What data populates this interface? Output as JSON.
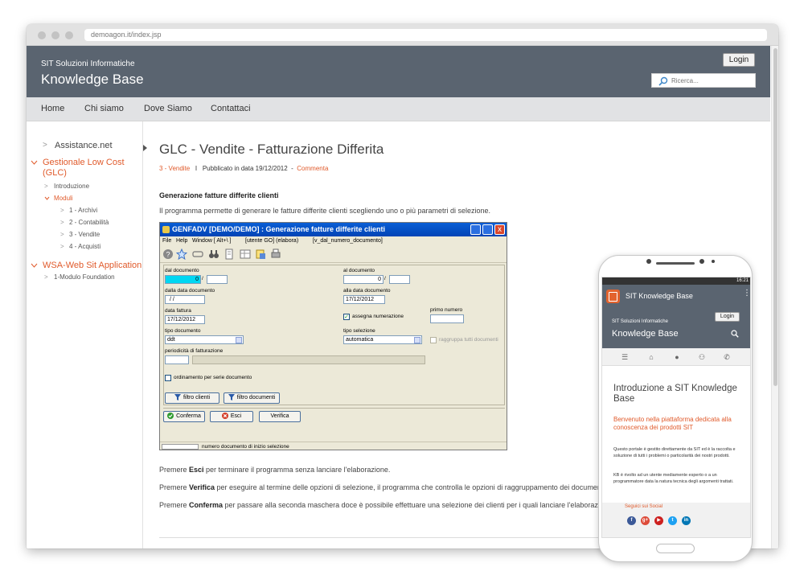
{
  "browser": {
    "url": "demoagon.it/index.jsp"
  },
  "header": {
    "company": "SIT Soluzioni Informatiche",
    "title": "Knowledge Base",
    "login_label": "Login",
    "search_placeholder": "Ricerca..."
  },
  "nav": {
    "items": [
      "Home",
      "Chi siamo",
      "Dove Siamo",
      "Contattaci"
    ]
  },
  "sidebar": {
    "items": [
      {
        "label": "Assistance.net"
      },
      {
        "label_line1": "Gestionale Low Cost",
        "label_line2": "(GLC)"
      },
      {
        "label": "Introduzione"
      },
      {
        "label": "Moduli"
      },
      {
        "label": "1 - Archivi"
      },
      {
        "label": "2 - Contabilità"
      },
      {
        "label": "3 - Vendite"
      },
      {
        "label": "4 - Acquisti"
      },
      {
        "label": "WSA-Web Sit Application"
      },
      {
        "label": "1-Modulo Foundation"
      }
    ]
  },
  "post": {
    "title": "GLC - Vendite - Fatturazione Differita",
    "category": "3 - Vendite",
    "separator": "I",
    "published": "Pubblicato in data 19/12/2012",
    "dash": "-",
    "comment": "Commenta",
    "section_title": "Generazione fatture differite clienti",
    "intro": "Il programma permette di generare le fatture differite clienti scegliendo uno o più parametri di selezione.",
    "paragraphs": [
      {
        "pre": "Premere ",
        "key": "Esci",
        "post": " per terminare il programma senza lanciare l'elaborazione."
      },
      {
        "pre": "Premere ",
        "key": "Verifica",
        "post": " per eseguire al termine delle opzioni di selezione, il programma che controlla le opzioni di raggruppamento dei documenti."
      },
      {
        "pre": "Premere ",
        "key": "Conferma",
        "post": " per passare alla seconda maschera doce è possibile effettuare una selezione dei clienti per i quali lanciare l'elaborazione."
      }
    ]
  },
  "app": {
    "title": "GENFADV [DEMO/DEMO] : Generazione fatture differite clienti",
    "close_glyph": "x",
    "menu": [
      "File",
      "Help",
      "Window [ Alt+\\ ]",
      "[utente GO] (elabora)",
      "[v_dal_numero_documento]"
    ],
    "fields": {
      "dal_documento_label": "dal documento",
      "dal_documento_value": "0",
      "al_documento_label": "al documento",
      "al_documento_value": "0",
      "slash": "/",
      "dalla_data_label": "dalla data documento",
      "dalla_data_value": "/ /",
      "alla_data_label": "alla data documento",
      "alla_data_value": "17/12/2012",
      "data_fattura_label": "data fattura",
      "data_fattura_value": "17/12/2012",
      "assegna_numerazione_label": "assegna numerazione",
      "primo_numero_label": "primo numero",
      "tipo_documento_label": "tipo documento",
      "tipo_documento_value": "ddt",
      "tipo_selezione_label": "tipo selezione",
      "tipo_selezione_value": "automatica",
      "raggruppa_label": "raggruppa tutti documenti",
      "periodicita_label": "periodicità di fatturazione",
      "ordinamento_label": "ordinamento per serie documento",
      "check_glyph": "✓"
    },
    "filter_buttons": [
      "filtro clienti",
      "filtro documenti"
    ],
    "action_buttons": [
      "Conferma",
      "Esci",
      "Verifica"
    ],
    "status_text": "numero documento di inizio selezione"
  },
  "mobile": {
    "time": "16:21",
    "app_title": "SIT Knowledge Base",
    "kebab": "⋮",
    "company": "SIT Soluzioni Informatiche",
    "title": "Knowledge Base",
    "login_label": "Login",
    "nav_icons": [
      "menu-icon",
      "home-icon",
      "user-icon",
      "org-icon",
      "phone-icon"
    ],
    "nav_glyphs": [
      "☰",
      "⌂",
      "●",
      "⚇",
      "✆"
    ],
    "h1": "Introduzione a SIT Knowledge Base",
    "h2": "Benvenuto nella piattaforma dedicata alla conoscenza dei prodotti SIT",
    "p1": "Questo portale è gestito direttamente da SIT ed è la raccolta e soluzione di tutti i problemi o particolarità dei nostri prodotti.",
    "p2": "KB è rivolto ad un utente mediamente esperto o a un programmatore data la natura tecnica degli argomenti trattati.",
    "social_title": "Seguici sui Social",
    "social": [
      {
        "name": "facebook",
        "glyph": "f",
        "color": "#3b5998"
      },
      {
        "name": "google-plus",
        "glyph": "g+",
        "color": "#dd4b39"
      },
      {
        "name": "youtube",
        "glyph": "▶",
        "color": "#cd201f"
      },
      {
        "name": "twitter",
        "glyph": "t",
        "color": "#1da1f2"
      },
      {
        "name": "linkedin",
        "glyph": "in",
        "color": "#0077b5"
      }
    ]
  }
}
